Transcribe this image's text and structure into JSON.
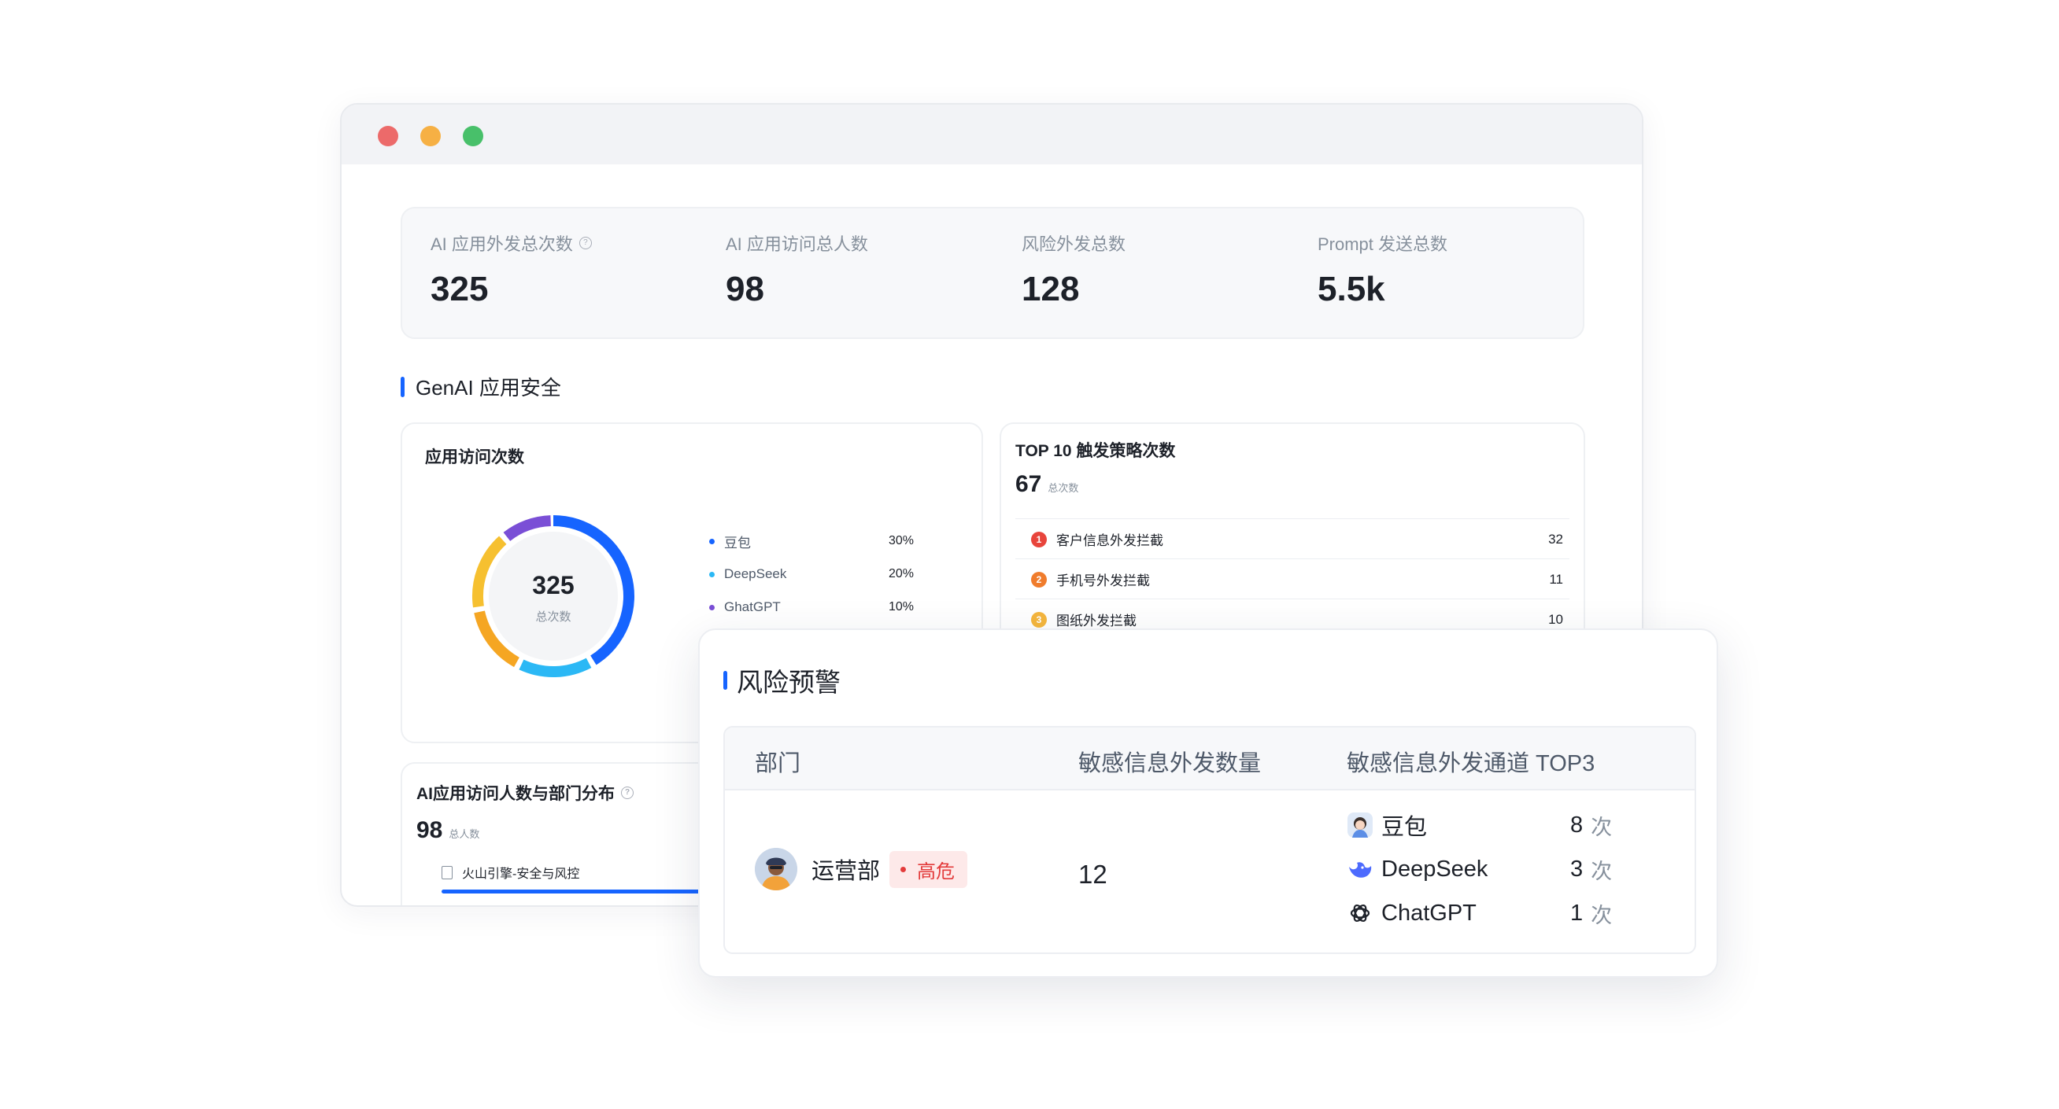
{
  "stats": [
    {
      "label": "AI 应用外发总次数",
      "value": "325",
      "help": true
    },
    {
      "label": "AI 应用访问总人数",
      "value": "98"
    },
    {
      "label": "风险外发总数",
      "value": "128"
    },
    {
      "label": "Prompt 发送总数",
      "value": "5.5k"
    }
  ],
  "section_title": "GenAI 应用安全",
  "visits_card": {
    "title": "应用访问次数",
    "center_value": "325",
    "center_label": "总次数",
    "legend": [
      {
        "name": "豆包",
        "pct": "30%",
        "color": "#1664ff"
      },
      {
        "name": "DeepSeek",
        "pct": "20%",
        "color": "#2bb8f5"
      },
      {
        "name": "GhatGPT",
        "pct": "10%",
        "color": "#7a4fd6"
      }
    ],
    "segments_colors": [
      "#1664ff",
      "#2bb8f5",
      "#f5a623",
      "#f6c030",
      "#7a4fd6"
    ]
  },
  "top_card": {
    "title": "TOP 10 触发策略次数",
    "total": "67",
    "total_label": "总次数",
    "rows": [
      {
        "rank": "1",
        "name": "客户信息外发拦截",
        "count": "32",
        "color": "#e8453c"
      },
      {
        "rank": "2",
        "name": "手机号外发拦截",
        "count": "11",
        "color": "#f07c2c"
      },
      {
        "rank": "3",
        "name": "图纸外发拦截",
        "count": "10",
        "color": "#f5b63d"
      }
    ]
  },
  "dept_card": {
    "title": "AI应用访问人数与部门分布",
    "total": "98",
    "total_label": "总人数",
    "row_label": "火山引擎-安全与风控"
  },
  "risk_card": {
    "title": "风险预警",
    "headers": [
      "部门",
      "敏感信息外发数量",
      "敏感信息外发通道 TOP3"
    ],
    "row": {
      "dept": "运营部",
      "tag": "高危",
      "count": "12",
      "channels": [
        {
          "name": "豆包",
          "count": "8",
          "unit": "次",
          "icon": "doubao-icon"
        },
        {
          "name": "DeepSeek",
          "count": "3",
          "unit": "次",
          "icon": "deepseek-icon"
        },
        {
          "name": "ChatGPT",
          "count": "1",
          "unit": "次",
          "icon": "chatgpt-icon"
        }
      ]
    }
  }
}
